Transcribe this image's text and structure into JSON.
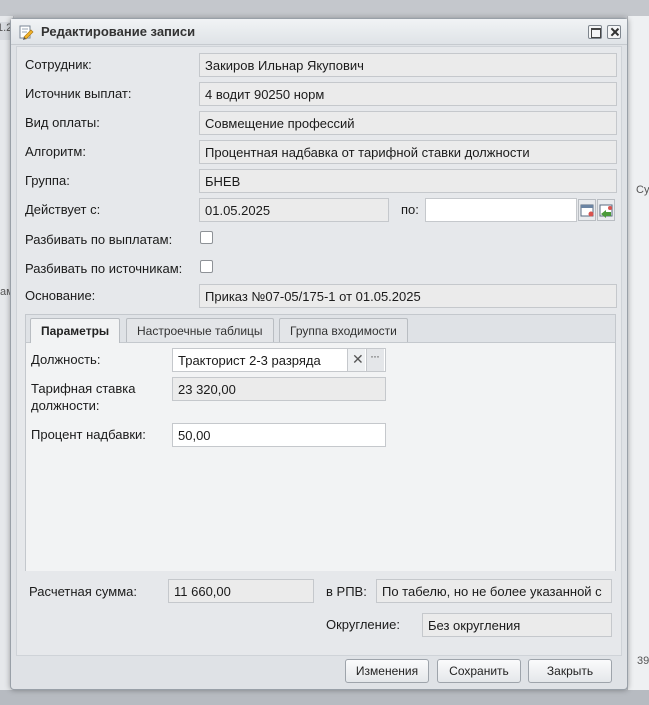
{
  "background": {
    "left_tab_label": "1.2",
    "right_col_label": "Су",
    "right_number": "39",
    "left_text": "ам"
  },
  "window": {
    "title": "Редактирование записи",
    "icon": "edit-document-icon"
  },
  "form": {
    "employee": {
      "label": "Сотрудник:",
      "value": "Закиров Ильнар Якупович"
    },
    "payment_source": {
      "label": "Источник выплат:",
      "value": "4 водит 90250 норм"
    },
    "payment_type": {
      "label": "Вид оплаты:",
      "value": "Совмещение профессий"
    },
    "algorithm": {
      "label": "Алгоритм:",
      "value": "Процентная надбавка от тарифной ставки должности"
    },
    "group": {
      "label": "Группа:",
      "value": "БНЕВ"
    },
    "valid_from": {
      "label": "Действует с:",
      "value": "01.05.2025",
      "to_label": "по:",
      "to_value": ""
    },
    "split_by_payments": {
      "label": "Разбивать по выплатам:",
      "checked": false
    },
    "split_by_sources": {
      "label": "Разбивать по источникам:",
      "checked": false
    },
    "basis": {
      "label": "Основание:",
      "value": "Приказ №07-05/175-1 от 01.05.2025"
    }
  },
  "tabs": [
    {
      "label": "Параметры",
      "active": true
    },
    {
      "label": "Настроечные таблицы",
      "active": false
    },
    {
      "label": "Группа входимости",
      "active": false
    }
  ],
  "params": {
    "position": {
      "label": "Должность:",
      "value": "Тракторист 2-3 разряда"
    },
    "tariff_rate": {
      "label_line1": "Тарифная ставка",
      "label_line2": "должности:",
      "value": "23 320,00"
    },
    "bonus_percent": {
      "label": "Процент надбавки:",
      "value": "50,00"
    }
  },
  "summary": {
    "calc_amount": {
      "label": "Расчетная сумма:",
      "value": "11 660,00"
    },
    "in_rpv": {
      "label": "в РПВ:",
      "value": "По табелю, но не более указанной с"
    },
    "rounding": {
      "label": "Округление:",
      "value": "Без округления"
    }
  },
  "buttons": {
    "changes": "Изменения",
    "save": "Сохранить",
    "close": "Закрыть"
  }
}
